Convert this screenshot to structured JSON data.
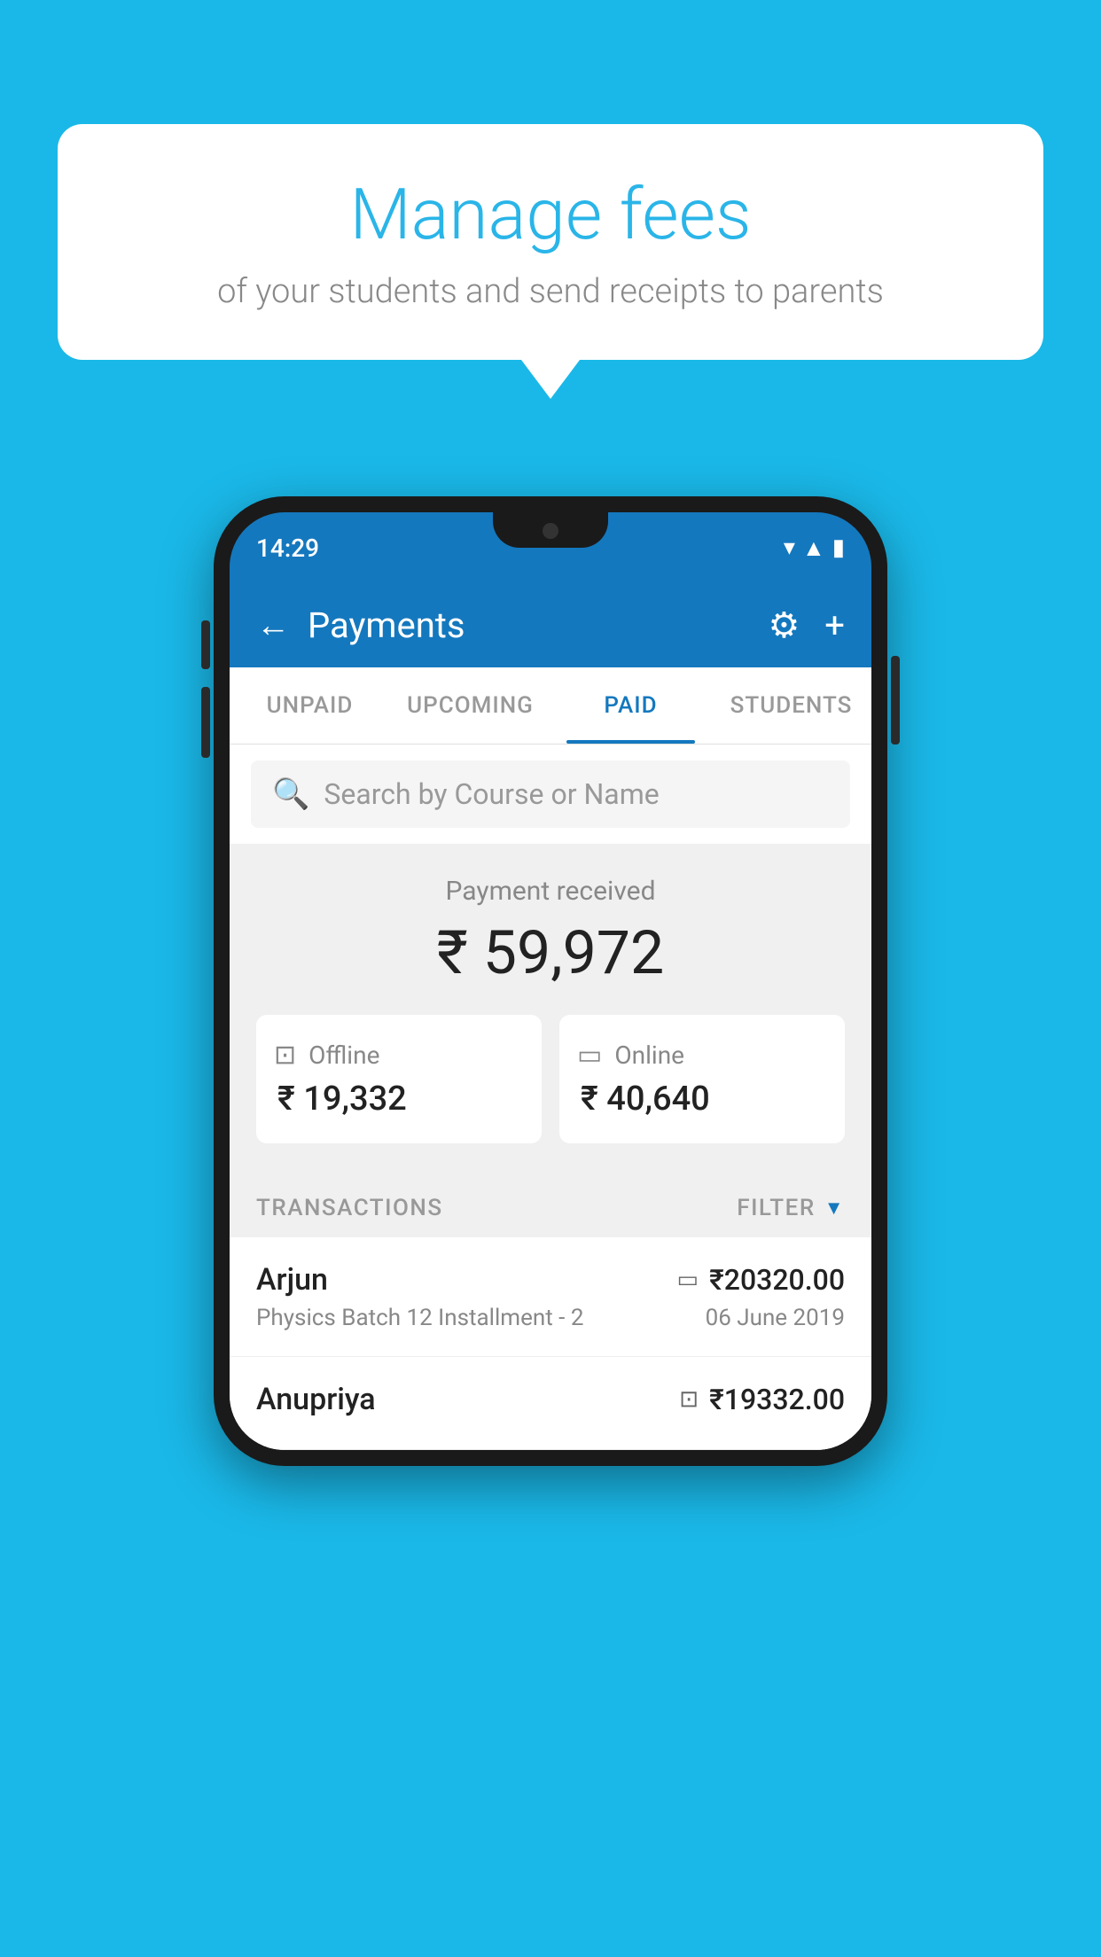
{
  "background_color": "#1ab8e8",
  "speech_bubble": {
    "title": "Manage fees",
    "subtitle": "of your students and send receipts to parents"
  },
  "phone": {
    "status_bar": {
      "time": "14:29"
    },
    "app_bar": {
      "title": "Payments",
      "back_label": "←",
      "gear_label": "⚙",
      "plus_label": "+"
    },
    "tabs": [
      {
        "label": "UNPAID",
        "active": false
      },
      {
        "label": "UPCOMING",
        "active": false
      },
      {
        "label": "PAID",
        "active": true
      },
      {
        "label": "STUDENTS",
        "active": false
      }
    ],
    "search": {
      "placeholder": "Search by Course or Name"
    },
    "payment_summary": {
      "label": "Payment received",
      "total": "₹ 59,972",
      "offline": {
        "label": "Offline",
        "amount": "₹ 19,332"
      },
      "online": {
        "label": "Online",
        "amount": "₹ 40,640"
      }
    },
    "transactions": {
      "header_label": "TRANSACTIONS",
      "filter_label": "FILTER",
      "rows": [
        {
          "name": "Arjun",
          "course": "Physics Batch 12 Installment - 2",
          "amount": "₹20320.00",
          "date": "06 June 2019",
          "payment_type": "online"
        },
        {
          "name": "Anupriya",
          "course": "",
          "amount": "₹19332.00",
          "date": "",
          "payment_type": "offline"
        }
      ]
    }
  }
}
